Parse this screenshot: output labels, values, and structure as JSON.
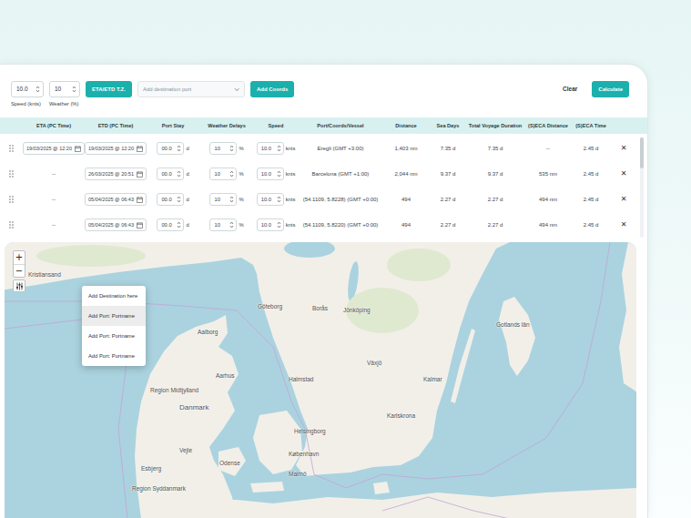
{
  "toolbar": {
    "speed": {
      "value": "10.0",
      "label": "Speed (knts)"
    },
    "weather": {
      "value": "10",
      "label": "Weather (%)"
    },
    "timezone_button": "ETA/ETD T.Z.",
    "destination": {
      "placeholder": "Add destination port"
    },
    "add_coords_button": "Add Coords",
    "clear_button": "Clear",
    "calculate_button": "Calculate"
  },
  "table": {
    "columns": [
      "ETA (PC Time)",
      "ETD (PC Time)",
      "Port Stay",
      "Weather Delays",
      "Speed",
      "Port/Coords/Vessel",
      "Distance",
      "Sea Days",
      "Total Voyage Duration",
      "(S)ECA Distance",
      "(S)ECA Time"
    ],
    "rows": [
      {
        "eta_kind": "field",
        "eta": "19/03/2025 @ 12:20",
        "etd": "19/03/2025 @ 12:20",
        "port_stay": "00.0",
        "port_stay_unit": "d",
        "weather_delay": "10",
        "weather_unit": "%",
        "speed": "10.0",
        "speed_unit": "knts",
        "port": "Eregli (GMT +3:00)",
        "distance": "1,403 nm",
        "sea_days": "7.35 d",
        "total_duration": "7.35 d",
        "seca_distance": "--",
        "seca_time": "2.45 d",
        "remove": "✕"
      },
      {
        "eta_kind": "plain",
        "eta": "--",
        "etd": "26/03/2025 @ 20:51",
        "port_stay": "00.0",
        "port_stay_unit": "d",
        "weather_delay": "10",
        "weather_unit": "%",
        "speed": "10.0",
        "speed_unit": "knts",
        "port": "Barcelona (GMT +1:00)",
        "distance": "2,044 nm",
        "sea_days": "9.37 d",
        "total_duration": "9.37 d",
        "seca_distance": "535 nm",
        "seca_time": "2.45 d",
        "remove": "✕"
      },
      {
        "eta_kind": "plain",
        "eta": "--",
        "etd": "05/04/2025 @ 06:43",
        "port_stay": "00.0",
        "port_stay_unit": "d",
        "weather_delay": "10",
        "weather_unit": "%",
        "speed": "10.0",
        "speed_unit": "knts",
        "port": "(54.1109, 5.8228) (GMT +0:00)",
        "distance": "494",
        "sea_days": "2.27 d",
        "total_duration": "2.27 d",
        "seca_distance": "494 nm",
        "seca_time": "2.45 d",
        "remove": "✕"
      },
      {
        "eta_kind": "plain",
        "eta": "--",
        "etd": "05/04/2025 @ 06:43",
        "port_stay": "00.0",
        "port_stay_unit": "d",
        "weather_delay": "10",
        "weather_unit": "%",
        "speed": "10.0",
        "speed_unit": "knts",
        "port": "(54.1109, 5.8220) (GMT +0:00)",
        "distance": "494",
        "sea_days": "2.27 d",
        "total_duration": "2.27 d",
        "seca_distance": "494 nm",
        "seca_time": "2.45 d",
        "remove": "✕"
      }
    ]
  },
  "map": {
    "zoom_in": "+",
    "zoom_out": "−",
    "labels": [
      "Kristiansand",
      "Göteborg",
      "Borås",
      "Jönköping",
      "Halmstad",
      "Växjö",
      "Kalmar",
      "Karlskrona",
      "Gotlands län",
      "Danmark",
      "Aalborg",
      "Aarhus",
      "Region Midtjylland",
      "Vejle",
      "Odense",
      "København",
      "Helsingborg",
      "Malmö",
      "Esbjerg",
      "Region Syddanmark"
    ]
  },
  "context_menu": {
    "items": [
      {
        "label": "Add Destination here",
        "selected": false
      },
      {
        "label": "Add Port: Portname",
        "selected": true
      },
      {
        "label": "Add Port: Portname",
        "selected": false
      },
      {
        "label": "Add Port: Portname",
        "selected": false
      }
    ]
  }
}
